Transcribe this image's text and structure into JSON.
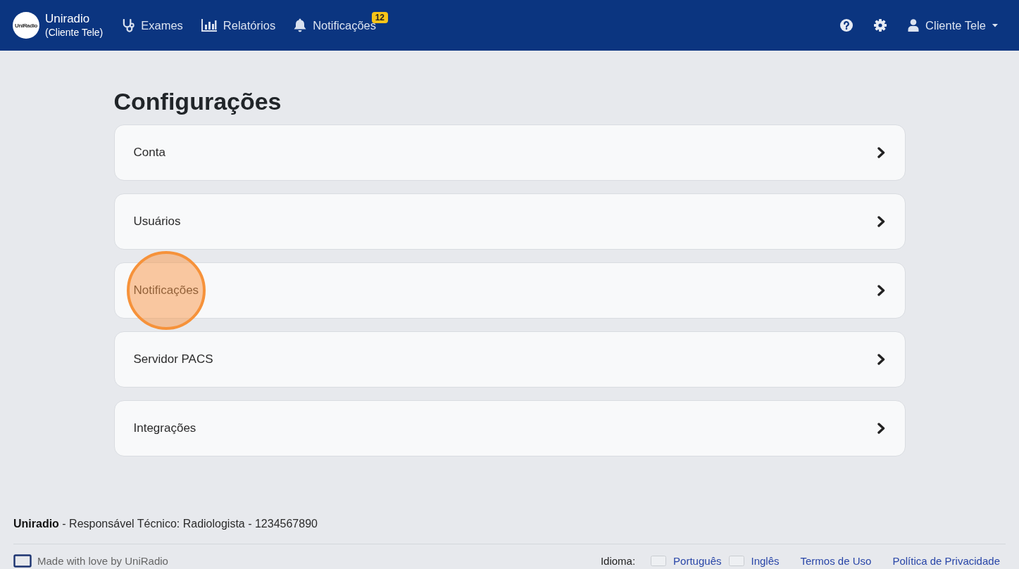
{
  "navbar": {
    "logo_text": "UniRadio",
    "brand": "Uniradio",
    "brand_subtitle": "(Cliente Tele)",
    "nav_items": [
      {
        "kind": "exams",
        "label": "Exames"
      },
      {
        "kind": "reports",
        "label": "Relatórios"
      },
      {
        "kind": "notifications",
        "label": "Notificações",
        "badge": "12"
      }
    ],
    "user_name": "Cliente Tele"
  },
  "page": {
    "title": "Configurações",
    "items": [
      {
        "label": "Conta",
        "highlighted": false
      },
      {
        "label": "Usuários",
        "highlighted": false
      },
      {
        "label": "Notificações",
        "highlighted": true
      },
      {
        "label": "Servidor PACS",
        "highlighted": false
      },
      {
        "label": "Integrações",
        "highlighted": false
      }
    ]
  },
  "footer": {
    "credit": "**Uniradio** - Responsável Técnico: Radiologista - 1234567890",
    "made_by": "Made with love by UniRadio",
    "language_label": "Idioma:",
    "languages": [
      "Português",
      "Inglês"
    ],
    "links": [
      "Termos de Uso",
      "Política de Privacidade"
    ]
  }
}
